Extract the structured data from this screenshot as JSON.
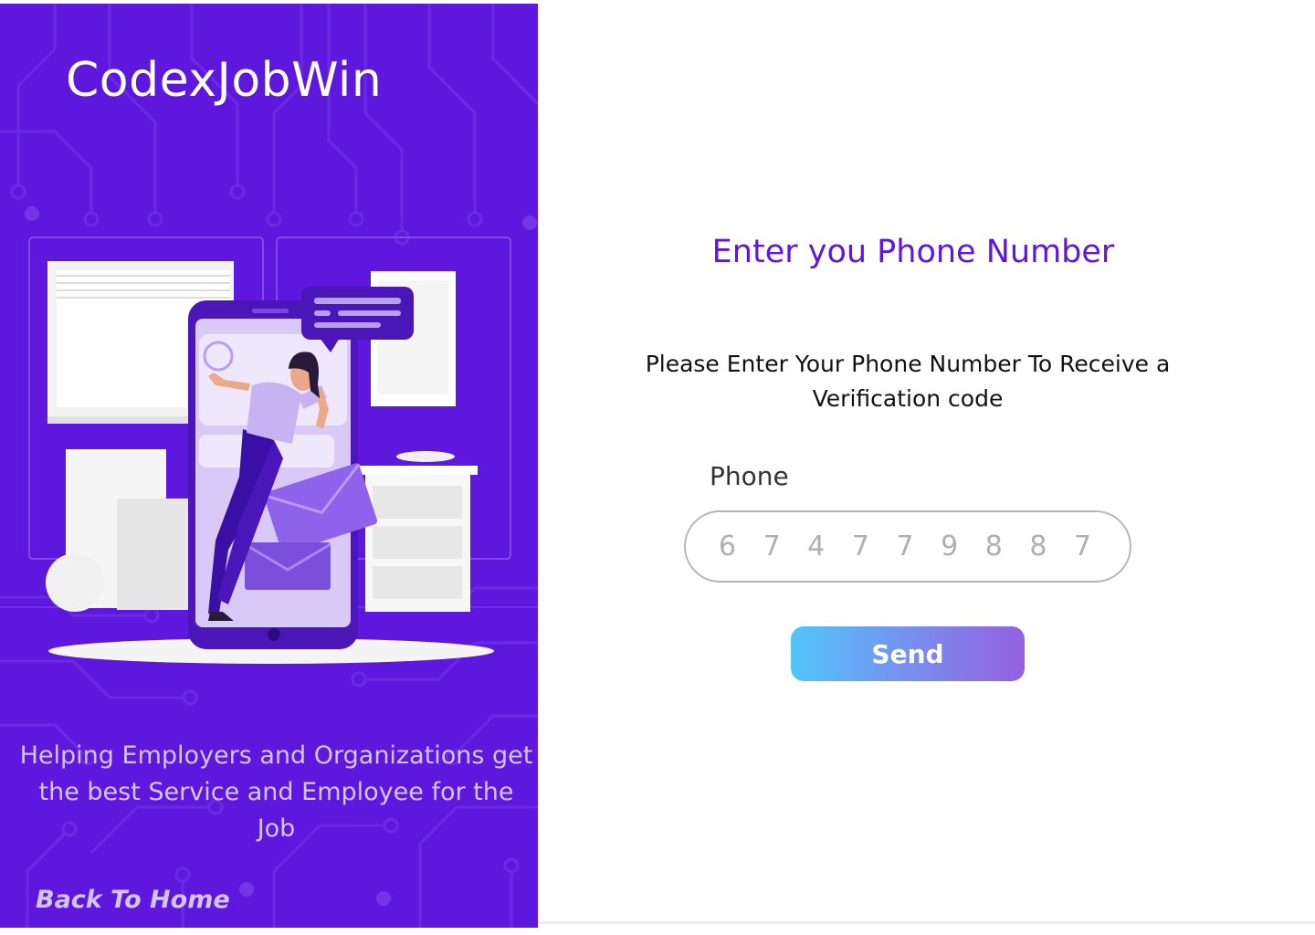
{
  "brand": {
    "name": "CodexJobWin"
  },
  "left_panel": {
    "tagline": "Helping Employers and Organizations get the best Service and Employee for the Job",
    "back_home_label": "Back To Home",
    "background_color": "#5e17dc",
    "illustration": "woman-with-phone-and-envelopes"
  },
  "form": {
    "title": "Enter you Phone Number",
    "description": "Please Enter Your Phone Number To Receive a Verification code",
    "phone_label": "Phone",
    "phone_placeholder": "674779887",
    "phone_value": "",
    "send_label": "Send",
    "title_color": "#5e17dc",
    "button_gradient": [
      "#52c5f9",
      "#9560e0"
    ]
  }
}
